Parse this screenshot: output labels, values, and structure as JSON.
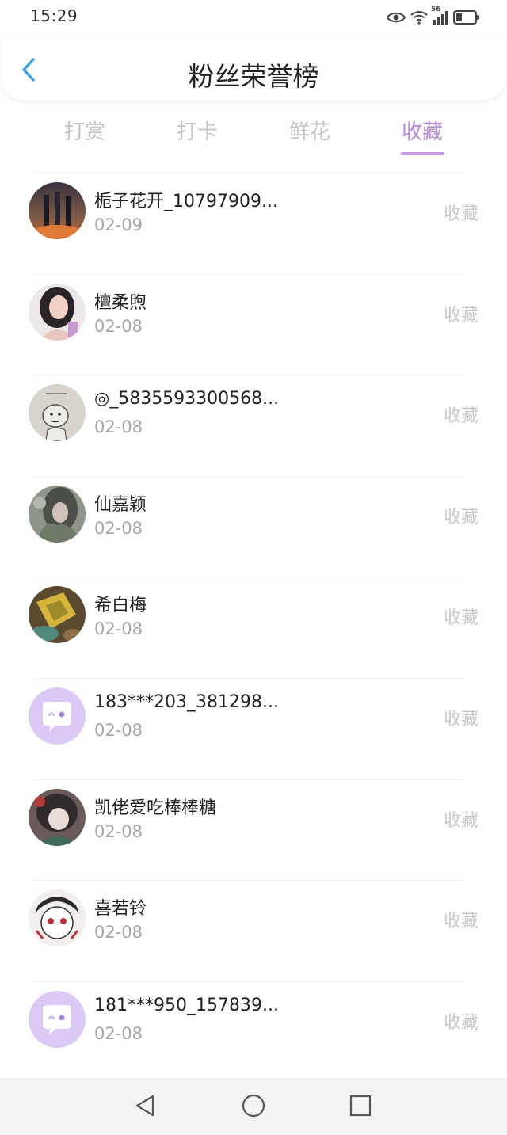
{
  "status_bar": {
    "time": "15:29",
    "network": "56",
    "icons": [
      "eye-icon",
      "wifi-icon",
      "signal-icon",
      "battery-icon"
    ]
  },
  "header": {
    "title": "粉丝荣誉榜",
    "back_icon": "chevron-left-icon"
  },
  "tabs": [
    {
      "label": "打赏",
      "active": false
    },
    {
      "label": "打卡",
      "active": false
    },
    {
      "label": "鲜花",
      "active": false
    },
    {
      "label": "收藏",
      "active": true
    }
  ],
  "colors": {
    "accent": "#b888dc",
    "back_arrow": "#3a9be6",
    "muted": "#c8c8c8"
  },
  "fans": [
    {
      "name": "栀子花开_10797909...",
      "date": "02-09",
      "action": "收藏",
      "avatar": "photo-avatar"
    },
    {
      "name": "檀柔煦",
      "date": "02-08",
      "action": "收藏",
      "avatar": "photo-avatar"
    },
    {
      "name": "◎_5835593300568...",
      "date": "02-08",
      "action": "收藏",
      "avatar": "photo-avatar"
    },
    {
      "name": "仙嘉颖",
      "date": "02-08",
      "action": "收藏",
      "avatar": "photo-avatar"
    },
    {
      "name": "希白梅",
      "date": "02-08",
      "action": "收藏",
      "avatar": "photo-avatar"
    },
    {
      "name": "183***203_381298...",
      "date": "02-08",
      "action": "收藏",
      "avatar": "default-chat-avatar"
    },
    {
      "name": "凯佬爱吃棒棒糖",
      "date": "02-08",
      "action": "收藏",
      "avatar": "photo-avatar"
    },
    {
      "name": "喜若铃",
      "date": "02-08",
      "action": "收藏",
      "avatar": "photo-avatar"
    },
    {
      "name": "181***950_157839...",
      "date": "02-08",
      "action": "收藏",
      "avatar": "default-chat-avatar"
    }
  ],
  "nav_bar": {
    "icons": [
      "back-triangle-icon",
      "home-circle-icon",
      "recents-square-icon"
    ]
  }
}
